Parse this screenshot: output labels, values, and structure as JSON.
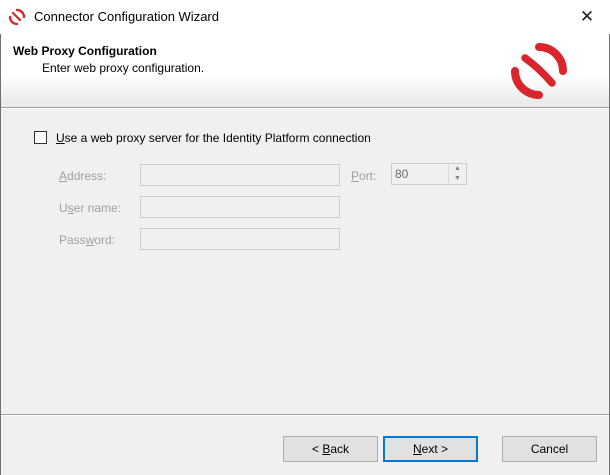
{
  "window": {
    "title": "Connector Configuration Wizard",
    "close_glyph": "✕"
  },
  "header": {
    "title": "Web Proxy Configuration",
    "subtitle": "Enter web proxy configuration."
  },
  "proxy": {
    "checkbox_checked": false,
    "checkbox_label_mnemonic": "U",
    "checkbox_label_rest": "se a web proxy server for the Identity Platform connection",
    "address_label_mnemonic": "A",
    "address_label_rest": "ddress:",
    "address_value": "",
    "port_label_mnemonic": "P",
    "port_label_rest": "ort:",
    "port_value": "80",
    "username_label_pre": "U",
    "username_label_mnemonic": "s",
    "username_label_rest": "er name:",
    "username_value": "",
    "password_label_pre": "Pass",
    "password_label_mnemonic": "w",
    "password_label_rest": "ord:",
    "password_value": ""
  },
  "buttons": {
    "back_pre": "< ",
    "back_mnemonic": "B",
    "back_rest": "ack",
    "next_mnemonic": "N",
    "next_rest": "ext >",
    "cancel": "Cancel"
  },
  "colors": {
    "brand_red": "#d9262c",
    "accent_blue": "#0078d7"
  }
}
